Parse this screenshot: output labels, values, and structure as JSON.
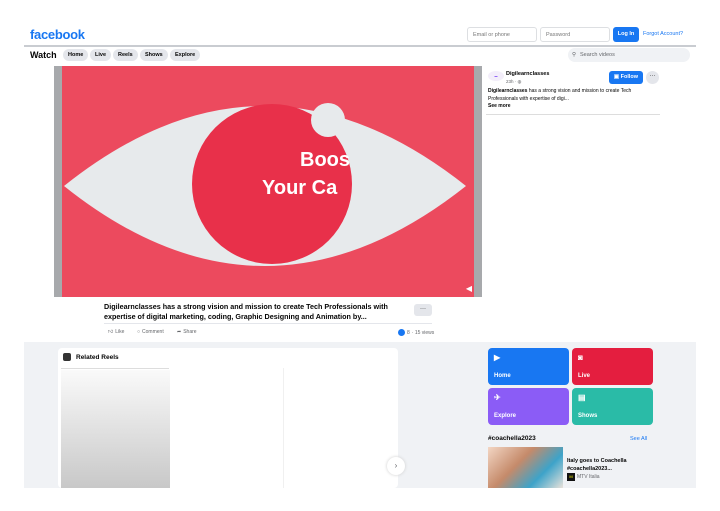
{
  "header": {
    "logo": "facebook",
    "email_placeholder": "Email or phone",
    "password_placeholder": "Password",
    "login": "Log In",
    "forgot": "Forgot Account?"
  },
  "watchbar": {
    "title": "Watch",
    "tabs": [
      "Home",
      "Live",
      "Reels",
      "Shows",
      "Explore"
    ],
    "search_placeholder": "Search videos"
  },
  "video": {
    "overlay_line1": "Boos",
    "overlay_line2": "Your Ca",
    "background_color": "#ec4a5e"
  },
  "post": {
    "page_name": "Digilearnclasses",
    "time": "23h ·",
    "follow": "Follow",
    "description_name": "Digilearnclasses",
    "description": "has a strong vision and mission to create Tech Professionals with expertise of digi...",
    "see_more": "See more",
    "caption": "Digilearnclasses has a strong vision and mission to create Tech Professionals with expertise of digital marketing, coding, Graphic Designing and Animation by...",
    "like": "Like",
    "comment": "Comment",
    "share": "Share",
    "reactions": "8",
    "views": "· 15 views"
  },
  "related": {
    "title": "Related Reels"
  },
  "nav_tiles": [
    {
      "label": "Home",
      "color": "#1877f2"
    },
    {
      "label": "Live",
      "color": "#e41e3f"
    },
    {
      "label": "Explore",
      "color": "#8b5cf6"
    },
    {
      "label": "Shows",
      "color": "#2abba7"
    }
  ],
  "hashtag": {
    "title": "#coachella2023",
    "see_all": "See All",
    "item_title": "Italy goes to Coachella #coachella2023...",
    "item_source": "MTV Italia"
  }
}
